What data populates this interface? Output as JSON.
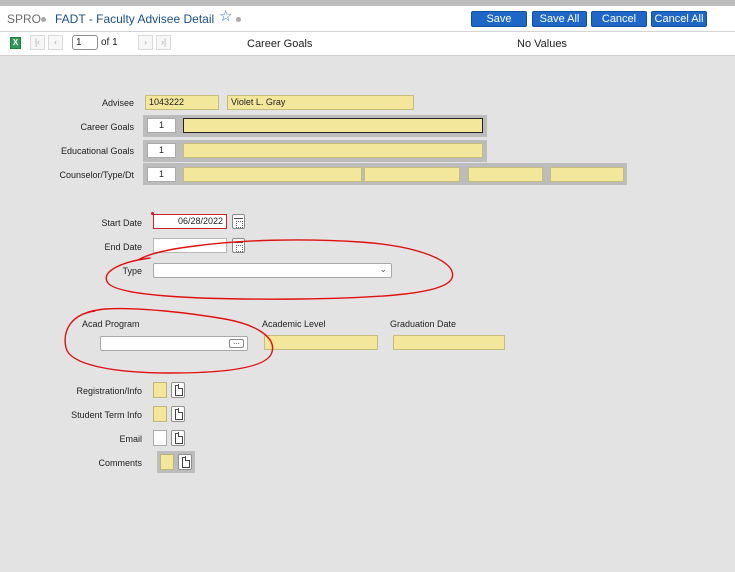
{
  "app": {
    "module": "SPRO",
    "title": "FADT - Faculty Advisee Detail"
  },
  "actions": {
    "save": "Save",
    "save_all": "Save All",
    "cancel": "Cancel",
    "cancel_all": "Cancel All"
  },
  "nav": {
    "page": "1",
    "of_label": "of 1",
    "column_label": "Career Goals",
    "value_status": "No Values"
  },
  "form": {
    "advisee_label": "Advisee",
    "advisee_id": "1043222",
    "advisee_name": "Violet L. Gray",
    "career_goals_label": "Career Goals",
    "career_goals_index": "1",
    "career_goals_value": "",
    "educational_goals_label": "Educational Goals",
    "educational_goals_index": "1",
    "educational_goals_value": "",
    "counselor_label": "Counselor/Type/Dt",
    "counselor_index": "1",
    "start_date_label": "Start Date",
    "start_date_value": "06/28/2022",
    "end_date_label": "End Date",
    "end_date_value": "",
    "type_label": "Type",
    "type_value": "",
    "acad_program_label": "Acad Program",
    "acad_program_value": "",
    "academic_level_label": "Academic Level",
    "academic_level_value": "",
    "graduation_date_label": "Graduation Date",
    "graduation_date_value": "",
    "registration_info_label": "Registration/Info",
    "student_term_info_label": "Student Term Info",
    "email_label": "Email",
    "comments_label": "Comments"
  },
  "colors": {
    "accent": "#1e67c6",
    "field_yellow": "#f2e79a",
    "annotation_red": "#e01010",
    "background": "#e3e3e3"
  },
  "icons": [
    "star-icon",
    "excel-icon",
    "first-page-icon",
    "prev-page-icon",
    "next-page-icon",
    "last-page-icon",
    "calendar-icon",
    "chevron-down-icon",
    "ellipsis-icon",
    "document-icon"
  ]
}
